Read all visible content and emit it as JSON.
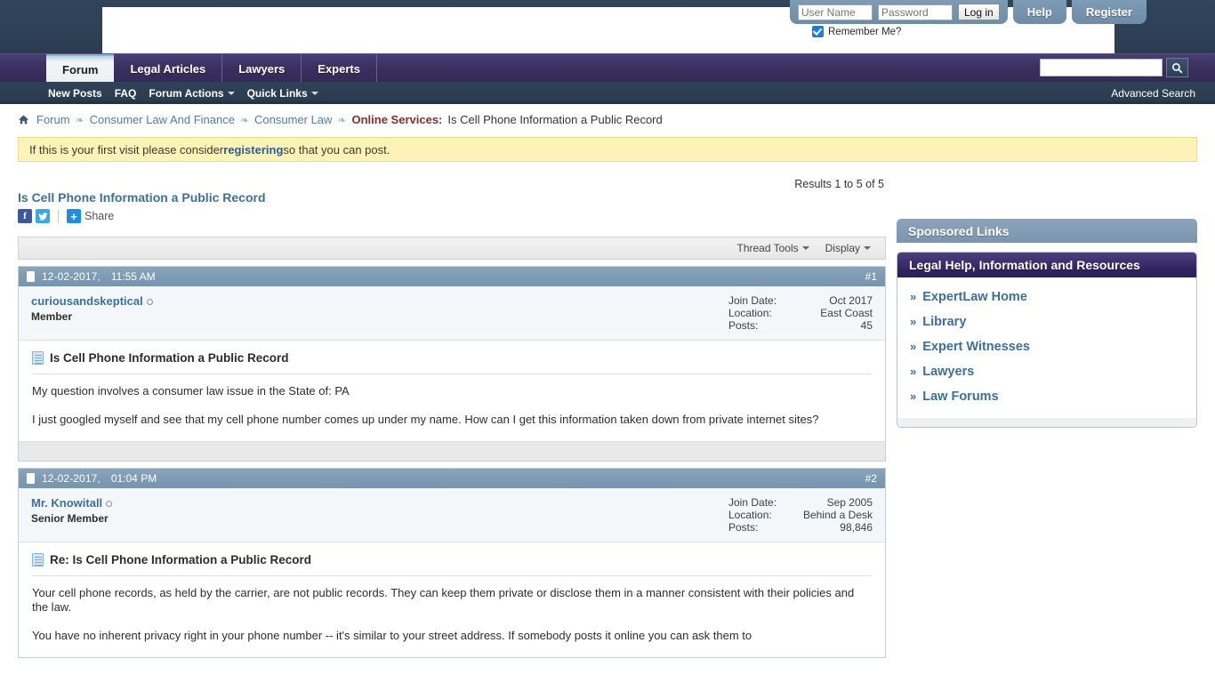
{
  "header": {
    "login": {
      "username_placeholder": "User Name",
      "username_value": "",
      "password_placeholder": "Password",
      "password_value": "",
      "login_label": "Log in",
      "remember_label": "Remember Me?"
    },
    "help_label": "Help",
    "register_label": "Register"
  },
  "nav": {
    "tabs": [
      {
        "label": "Forum",
        "active": true
      },
      {
        "label": "Legal Articles",
        "active": false
      },
      {
        "label": "Lawyers",
        "active": false
      },
      {
        "label": "Experts",
        "active": false
      }
    ],
    "search_value": "",
    "search_placeholder": "",
    "search_icon": "search-icon",
    "sub_links": [
      {
        "label": "New Posts",
        "caret": false
      },
      {
        "label": "FAQ",
        "caret": false
      },
      {
        "label": "Forum Actions",
        "caret": true
      },
      {
        "label": "Quick Links",
        "caret": true
      }
    ],
    "advanced_search_label": "Advanced Search"
  },
  "breadcrumb": {
    "home_icon": "home-icon",
    "items": [
      {
        "label": "Forum",
        "type": "link"
      },
      {
        "label": "Consumer Law And Finance",
        "type": "link"
      },
      {
        "label": "Consumer Law",
        "type": "link"
      },
      {
        "label": "Online Services:",
        "type": "category"
      },
      {
        "label": "Is Cell Phone Information a Public Record",
        "type": "current"
      }
    ],
    "separator": "❧"
  },
  "notice": {
    "prefix": "If this is your first visit please consider ",
    "link": "registering",
    "suffix": " so that you can post."
  },
  "results_line": "Results 1 to 5 of 5",
  "thread": {
    "title": "Is Cell Phone Information a Public Record",
    "share": {
      "facebook": "f",
      "twitter": "🐦",
      "plus": "+",
      "label": "Share"
    },
    "tools": [
      {
        "label": "Thread Tools"
      },
      {
        "label": "Display"
      }
    ]
  },
  "posts": [
    {
      "date": "12-02-2017,",
      "time": "11:55 AM",
      "number": "#1",
      "author": "curiousandskeptical",
      "usertitle": "Member",
      "stats": [
        {
          "label": "Join Date:",
          "value": "Oct 2017"
        },
        {
          "label": "Location:",
          "value": "East Coast"
        },
        {
          "label": "Posts:",
          "value": "45"
        }
      ],
      "subject": "Is Cell Phone Information a Public Record",
      "paragraphs": [
        "My question involves a consumer law issue in the State of: PA",
        "I just googled myself and see that my cell phone number comes up under my name. How can I get this information taken down from private internet sites?"
      ]
    },
    {
      "date": "12-02-2017,",
      "time": "01:04 PM",
      "number": "#2",
      "author": "Mr. Knowitall",
      "usertitle": "Senior Member",
      "stats": [
        {
          "label": "Join Date:",
          "value": "Sep 2005"
        },
        {
          "label": "Location:",
          "value": "Behind a Desk"
        },
        {
          "label": "Posts:",
          "value": "98,846"
        }
      ],
      "subject": "Re: Is Cell Phone Information a Public Record",
      "paragraphs": [
        "Your cell phone records, as held by the carrier, are not public records. They can keep them private or disclose them in a manner consistent with their policies and the law.",
        "You have no inherent privacy right in your phone number -- it's similar to your street address. If somebody posts it online you can ask them to"
      ]
    }
  ],
  "sidebar": {
    "sponsored_title": "Sponsored Links",
    "resources_title": "Legal Help, Information and Resources",
    "resource_links": [
      {
        "label": "ExpertLaw Home"
      },
      {
        "label": "Library"
      },
      {
        "label": "Expert Witnesses"
      },
      {
        "label": "Lawyers"
      },
      {
        "label": "Law Forums"
      }
    ],
    "chevron": "»"
  },
  "colors": {
    "header_bg": "#2e4156",
    "nav_bg": "#3b3161",
    "post_head": "#7d9ab3",
    "link_blue": "#3f6f99",
    "notice_bg": "#fdf3b6",
    "category_red": "#8c2b2b",
    "purple_panel": "#2e2560"
  }
}
